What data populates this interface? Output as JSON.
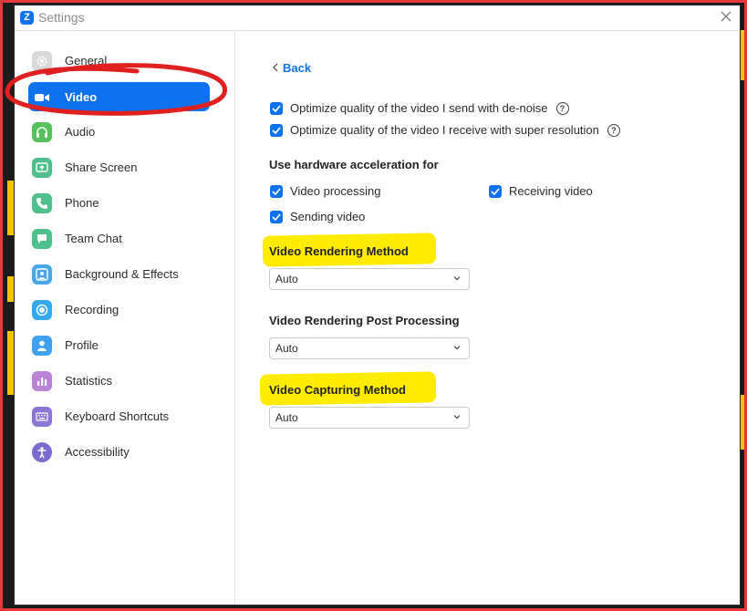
{
  "window": {
    "title": "Settings"
  },
  "sidebar": {
    "items": [
      {
        "label": "General",
        "icon": "gear-icon",
        "color": "#d7d7d7"
      },
      {
        "label": "Video",
        "icon": "video-camera-icon",
        "color": "#0e72ed",
        "active": true
      },
      {
        "label": "Audio",
        "icon": "headphones-icon",
        "color": "#57c15e"
      },
      {
        "label": "Share Screen",
        "icon": "share-screen-icon",
        "color": "#4fbf8b"
      },
      {
        "label": "Phone",
        "icon": "phone-icon",
        "color": "#4fbf8b"
      },
      {
        "label": "Team Chat",
        "icon": "chat-icon",
        "color": "#4fbf8b"
      },
      {
        "label": "Background & Effects",
        "icon": "background-icon",
        "color": "#4aa8e8"
      },
      {
        "label": "Recording",
        "icon": "record-icon",
        "color": "#32a9ec"
      },
      {
        "label": "Profile",
        "icon": "profile-icon",
        "color": "#3ea1ef"
      },
      {
        "label": "Statistics",
        "icon": "statistics-icon",
        "color": "#b983d6"
      },
      {
        "label": "Keyboard Shortcuts",
        "icon": "keyboard-icon",
        "color": "#8a76d4"
      },
      {
        "label": "Accessibility",
        "icon": "accessibility-icon",
        "color": "#7b6bd0"
      }
    ]
  },
  "main": {
    "back_label": "Back",
    "options": [
      {
        "label": "Optimize quality of the video I send with de-noise",
        "checked": true,
        "help": true
      },
      {
        "label": "Optimize quality of the video I receive with super resolution",
        "checked": true,
        "help": true
      }
    ],
    "hw_accel": {
      "title": "Use hardware acceleration for",
      "video_processing": {
        "label": "Video processing",
        "checked": true
      },
      "receiving_video": {
        "label": "Receiving video",
        "checked": true
      },
      "sending_video": {
        "label": "Sending video",
        "checked": true
      }
    },
    "rendering_method": {
      "title": "Video Rendering Method",
      "value": "Auto",
      "highlighted": true
    },
    "rendering_post": {
      "title": "Video Rendering Post Processing",
      "value": "Auto"
    },
    "capturing_method": {
      "title": "Video Capturing Method",
      "value": "Auto",
      "highlighted": true
    }
  },
  "colors": {
    "accent": "#0e72ed",
    "highlight": "#ffec00",
    "annotation": "#e01f1f"
  }
}
